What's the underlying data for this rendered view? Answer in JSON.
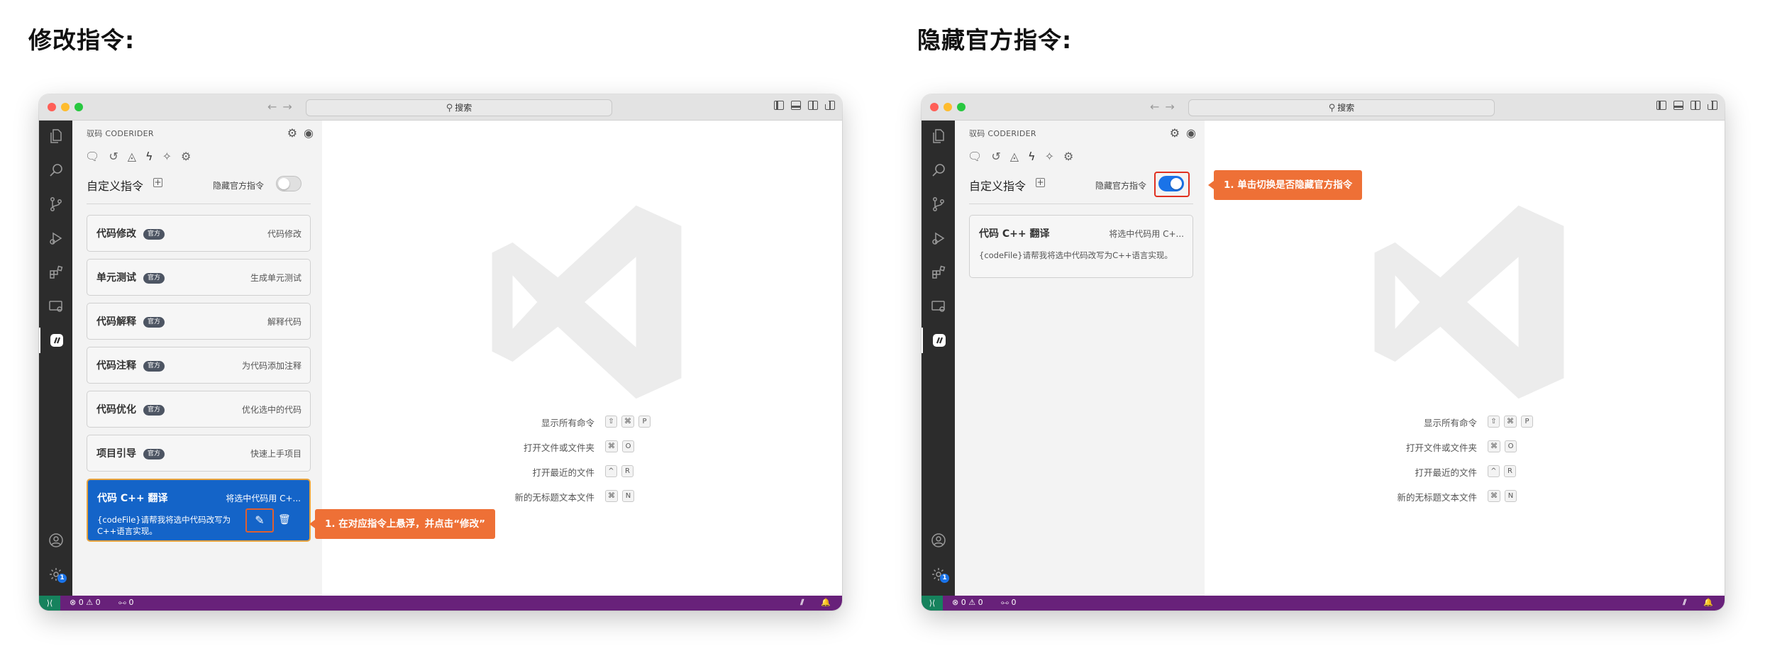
{
  "headings": {
    "left": "修改指令:",
    "right": "隐藏官方指令:"
  },
  "window": {
    "search_label": "搜索",
    "sidebar_title": "驭码 CODERIDER",
    "section_title": "自定义指令",
    "hide_label": "隐藏官方指令",
    "official_tag": "官方",
    "commands": [
      {
        "name": "代码修改",
        "desc": "代码修改"
      },
      {
        "name": "单元测试",
        "desc": "生成单元测试"
      },
      {
        "name": "代码解释",
        "desc": "解释代码"
      },
      {
        "name": "代码注释",
        "desc": "为代码添加注释"
      },
      {
        "name": "代码优化",
        "desc": "优化选中的代码"
      },
      {
        "name": "项目引导",
        "desc": "快速上手项目"
      }
    ],
    "custom_command": {
      "name": "代码 C++ 翻译",
      "desc_left": "将选中代码用 C+...",
      "desc_right": "将选中代码用 C+...",
      "body": "{codeFile}请帮我将选中代码改写为C++语言实现。"
    },
    "shortcuts": [
      {
        "label": "显示所有命令",
        "keys": [
          "⇧",
          "⌘",
          "P"
        ]
      },
      {
        "label": "打开文件或文件夹",
        "keys": [
          "⌘",
          "O"
        ]
      },
      {
        "label": "打开最近的文件",
        "keys": [
          "^",
          "R"
        ]
      },
      {
        "label": "新的无标题文本文件",
        "keys": [
          "⌘",
          "N"
        ]
      }
    ],
    "status": {
      "errors": "0",
      "warnings": "0",
      "ports": "0"
    },
    "left_toggle_on": false,
    "right_toggle_on": true
  },
  "callouts": {
    "left": "1. 在对应指令上悬浮，并点击“修改”",
    "right": "1. 单击切换是否隐藏官方指令"
  },
  "colors": {
    "callout": "#ee7036",
    "statusbar": "#68217a",
    "selected_card": "#1464c8",
    "toggle_on": "#1a73e8"
  }
}
